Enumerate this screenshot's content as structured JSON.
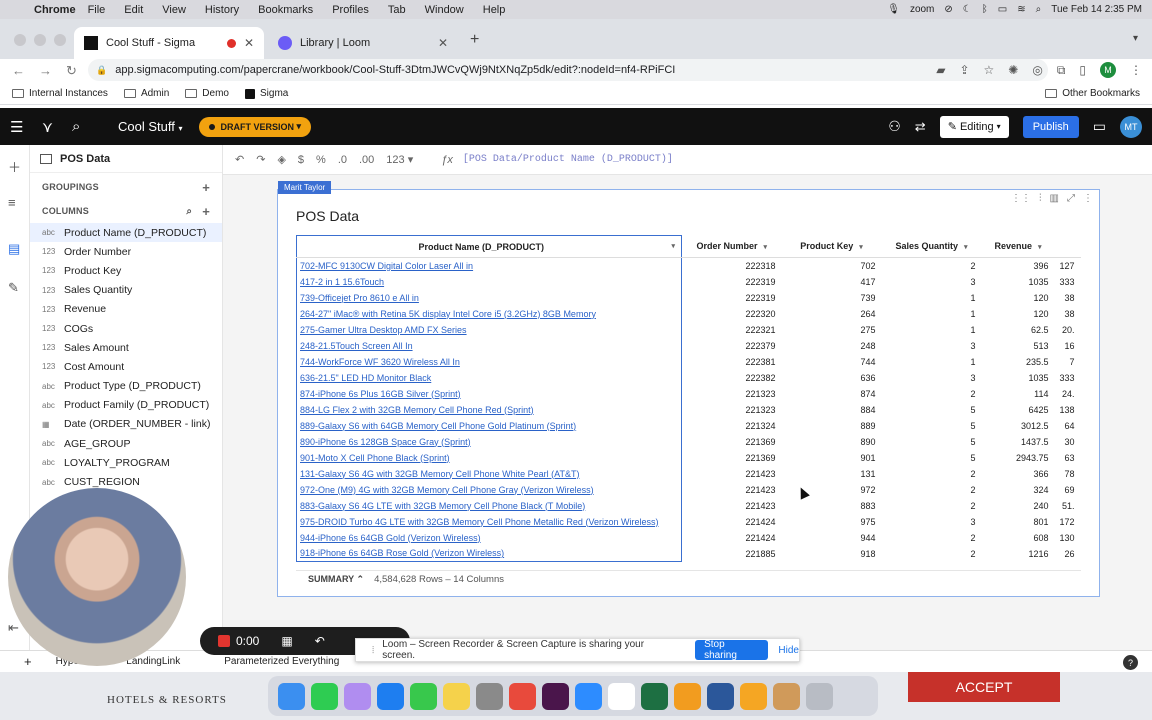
{
  "menubar": {
    "app": "Chrome",
    "items": [
      "File",
      "Edit",
      "View",
      "History",
      "Bookmarks",
      "Profiles",
      "Tab",
      "Window",
      "Help"
    ],
    "zoom_label": "zoom",
    "datetime": "Tue Feb 14  2:35 PM"
  },
  "tabs": [
    {
      "label": "Cool Stuff - Sigma",
      "active": true
    },
    {
      "label": "Library | Loom",
      "active": false
    }
  ],
  "address": {
    "url": "app.sigmacomputing.com/papercrane/workbook/Cool-Stuff-3DtmJWCvQWj9NtXNqZp5dk/edit?:nodeId=nf4-RPiFCI"
  },
  "bookmarks": {
    "items": [
      "Internal Instances",
      "Admin",
      "Demo",
      "Sigma"
    ],
    "other": "Other Bookmarks"
  },
  "sigma": {
    "workbook_title": "Cool Stuff",
    "draft_label": "DRAFT VERSION",
    "editing_label": "Editing",
    "publish_label": "Publish",
    "user_initials": "MT",
    "accent": "#2b6fe6",
    "draft_color": "#f2a20f"
  },
  "panel": {
    "title": "POS Data",
    "groupings_label": "GROUPINGS",
    "columns_label": "COLUMNS",
    "columns": [
      {
        "type": "abc",
        "name": "Product Name (D_PRODUCT)",
        "selected": true
      },
      {
        "type": "123",
        "name": "Order Number"
      },
      {
        "type": "123",
        "name": "Product Key"
      },
      {
        "type": "123",
        "name": "Sales Quantity"
      },
      {
        "type": "123",
        "name": "Revenue"
      },
      {
        "type": "123",
        "name": "COGs"
      },
      {
        "type": "123",
        "name": "Sales Amount"
      },
      {
        "type": "123",
        "name": "Cost Amount"
      },
      {
        "type": "abc",
        "name": "Product Type (D_PRODUCT)"
      },
      {
        "type": "abc",
        "name": "Product Family (D_PRODUCT)"
      },
      {
        "type": "▦",
        "name": "Date (ORDER_NUMBER - link)"
      },
      {
        "type": "abc",
        "name": "AGE_GROUP"
      },
      {
        "type": "abc",
        "name": "LOYALTY_PROGRAM"
      },
      {
        "type": "abc",
        "name": "CUST_REGION"
      }
    ]
  },
  "formula_bar": {
    "format_label": "123",
    "expression": "[POS Data/Product Name (D_PRODUCT)]"
  },
  "card": {
    "author": "Marit Taylor",
    "title": "POS Data",
    "headers": [
      "Product Name (D_PRODUCT)",
      "Order Number",
      "Product Key",
      "Sales Quantity",
      "Revenue"
    ],
    "rows": [
      [
        "702-MFC 9130CW Digital Color Laser All in",
        "222318",
        "702",
        "2",
        "396",
        "127"
      ],
      [
        "417-2 in 1 15.6Touch",
        "222319",
        "417",
        "3",
        "1035",
        "333"
      ],
      [
        "739-Officejet Pro 8610 e All in",
        "222319",
        "739",
        "1",
        "120",
        "38"
      ],
      [
        "264-27\" iMac® with Retina 5K display   Intel Core i5 (3.2GHz)   8GB Memory",
        "222320",
        "264",
        "1",
        "120",
        "38"
      ],
      [
        "275-Gamer Ultra Desktop   AMD FX Series",
        "222321",
        "275",
        "1",
        "62.5",
        "20."
      ],
      [
        "248-21.5Touch Screen All In",
        "222379",
        "248",
        "3",
        "513",
        "16"
      ],
      [
        "744-WorkForce WF 3620 Wireless All In",
        "222381",
        "744",
        "1",
        "235.5",
        "7"
      ],
      [
        "636-21.5\" LED HD Monitor   Black",
        "222382",
        "636",
        "3",
        "1035",
        "333"
      ],
      [
        "874-iPhone 6s Plus 16GB   Silver (Sprint)",
        "221323",
        "874",
        "2",
        "114",
        "24."
      ],
      [
        "884-LG Flex 2 with 32GB Memory Cell Phone   Red (Sprint)",
        "221323",
        "884",
        "5",
        "6425",
        "138"
      ],
      [
        "889-Galaxy S6 with 64GB Memory Cell Phone   Gold Platinum (Sprint)",
        "221324",
        "889",
        "5",
        "3012.5",
        "64"
      ],
      [
        "890-iPhone 6s 128GB   Space Gray (Sprint)",
        "221369",
        "890",
        "5",
        "1437.5",
        "30"
      ],
      [
        "901-Moto X Cell Phone   Black (Sprint)",
        "221369",
        "901",
        "5",
        "2943.75",
        "63"
      ],
      [
        "131-Galaxy S6 4G with 32GB Memory Cell Phone   White Pearl (AT&T)",
        "221423",
        "131",
        "2",
        "366",
        "78"
      ],
      [
        "972-One (M9) 4G with 32GB Memory Cell Phone   Gray (Verizon Wireless)",
        "221423",
        "972",
        "2",
        "324",
        "69"
      ],
      [
        "883-Galaxy S6 4G LTE with 32GB Memory Cell Phone   Black (T Mobile)",
        "221423",
        "883",
        "2",
        "240",
        "51."
      ],
      [
        "975-DROID Turbo 4G LTE with 32GB Memory Cell Phone   Metallic Red (Verizon Wireless)",
        "221424",
        "975",
        "3",
        "801",
        "172"
      ],
      [
        "944-iPhone 6s 64GB   Gold (Verizon Wireless)",
        "221424",
        "944",
        "2",
        "608",
        "130"
      ],
      [
        "918-iPhone 6s 64GB   Rose Gold (Verizon Wireless)",
        "221885",
        "918",
        "2",
        "1216",
        "26"
      ]
    ],
    "summary_label": "SUMMARY",
    "summary_text": "4,584,628 Rows – 14 Columns"
  },
  "sheet_tabs": [
    "Hyper",
    "LandingLink",
    "Parameterized Everything"
  ],
  "recording": {
    "timer": "0:00",
    "share_message": "Loom – Screen Recorder & Screen Capture is sharing your screen.",
    "stop_label": "Stop sharing",
    "hide_label": "Hide"
  },
  "background_ad": {
    "brand": "HOTELS & RESORTS",
    "accept_label": "ACCEPT"
  },
  "dock_icons": [
    "finder-icon",
    "facetime-icon",
    "launchpad-icon",
    "safari-icon",
    "messages-icon",
    "notes-icon",
    "settings-icon",
    "chrome-icon",
    "slack-icon",
    "zoom-icon",
    "calendar-icon",
    "excel-icon",
    "sublime-icon",
    "word-icon",
    "photos-icon",
    "package-icon",
    "trash-icon"
  ]
}
